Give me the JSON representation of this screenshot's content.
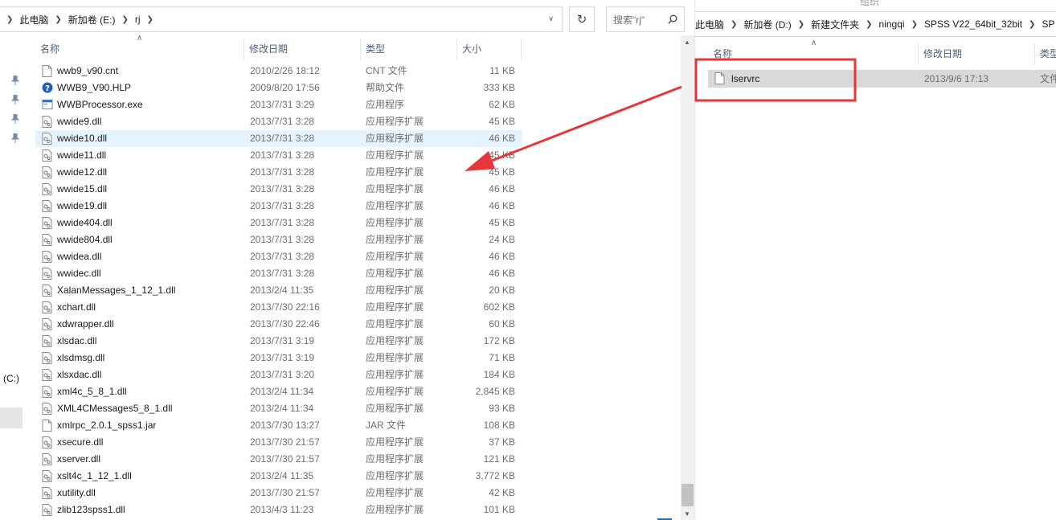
{
  "left_window": {
    "breadcrumb": [
      "此电脑",
      "新加卷 (E:)",
      "rj"
    ],
    "search_placeholder": "搜索\"rj\"",
    "columns": {
      "name": "名称",
      "date": "修改日期",
      "type": "类型",
      "size": "大小"
    },
    "nav": {
      "c_drive_label": "(C:)"
    },
    "files": [
      {
        "name": "wwb9_v90.cnt",
        "date": "2010/2/26 18:12",
        "type": "CNT 文件",
        "size": "11 KB",
        "icon": "file-icon"
      },
      {
        "name": "WWB9_V90.HLP",
        "date": "2009/8/20 17:56",
        "type": "帮助文件",
        "size": "333 KB",
        "icon": "help-file-icon"
      },
      {
        "name": "WWBProcessor.exe",
        "date": "2013/7/31 3:29",
        "type": "应用程序",
        "size": "62 KB",
        "icon": "exe-icon"
      },
      {
        "name": "wwide9.dll",
        "date": "2013/7/31 3:28",
        "type": "应用程序扩展",
        "size": "45 KB",
        "icon": "dll-icon"
      },
      {
        "name": "wwide10.dll",
        "date": "2013/7/31 3:28",
        "type": "应用程序扩展",
        "size": "46 KB",
        "icon": "dll-icon",
        "hover": true
      },
      {
        "name": "wwide11.dll",
        "date": "2013/7/31 3:28",
        "type": "应用程序扩展",
        "size": "45 KB",
        "icon": "dll-icon"
      },
      {
        "name": "wwide12.dll",
        "date": "2013/7/31 3:28",
        "type": "应用程序扩展",
        "size": "45 KB",
        "icon": "dll-icon"
      },
      {
        "name": "wwide15.dll",
        "date": "2013/7/31 3:28",
        "type": "应用程序扩展",
        "size": "46 KB",
        "icon": "dll-icon"
      },
      {
        "name": "wwide19.dll",
        "date": "2013/7/31 3:28",
        "type": "应用程序扩展",
        "size": "46 KB",
        "icon": "dll-icon"
      },
      {
        "name": "wwide404.dll",
        "date": "2013/7/31 3:28",
        "type": "应用程序扩展",
        "size": "45 KB",
        "icon": "dll-icon"
      },
      {
        "name": "wwide804.dll",
        "date": "2013/7/31 3:28",
        "type": "应用程序扩展",
        "size": "24 KB",
        "icon": "dll-icon"
      },
      {
        "name": "wwidea.dll",
        "date": "2013/7/31 3:28",
        "type": "应用程序扩展",
        "size": "46 KB",
        "icon": "dll-icon"
      },
      {
        "name": "wwidec.dll",
        "date": "2013/7/31 3:28",
        "type": "应用程序扩展",
        "size": "46 KB",
        "icon": "dll-icon"
      },
      {
        "name": "XalanMessages_1_12_1.dll",
        "date": "2013/2/4 11:35",
        "type": "应用程序扩展",
        "size": "20 KB",
        "icon": "dll-icon"
      },
      {
        "name": "xchart.dll",
        "date": "2013/7/30 22:16",
        "type": "应用程序扩展",
        "size": "602 KB",
        "icon": "dll-icon"
      },
      {
        "name": "xdwrapper.dll",
        "date": "2013/7/30 22:46",
        "type": "应用程序扩展",
        "size": "60 KB",
        "icon": "dll-icon"
      },
      {
        "name": "xlsdac.dll",
        "date": "2013/7/31 3:19",
        "type": "应用程序扩展",
        "size": "172 KB",
        "icon": "dll-icon"
      },
      {
        "name": "xlsdmsg.dll",
        "date": "2013/7/31 3:19",
        "type": "应用程序扩展",
        "size": "71 KB",
        "icon": "dll-icon"
      },
      {
        "name": "xlsxdac.dll",
        "date": "2013/7/31 3:20",
        "type": "应用程序扩展",
        "size": "184 KB",
        "icon": "dll-icon"
      },
      {
        "name": "xml4c_5_8_1.dll",
        "date": "2013/2/4 11:34",
        "type": "应用程序扩展",
        "size": "2,845 KB",
        "icon": "dll-icon"
      },
      {
        "name": "XML4CMessages5_8_1.dll",
        "date": "2013/2/4 11:34",
        "type": "应用程序扩展",
        "size": "93 KB",
        "icon": "dll-icon"
      },
      {
        "name": "xmlrpc_2.0.1_spss1.jar",
        "date": "2013/7/30 13:27",
        "type": "JAR 文件",
        "size": "108 KB",
        "icon": "file-icon"
      },
      {
        "name": "xsecure.dll",
        "date": "2013/7/30 21:57",
        "type": "应用程序扩展",
        "size": "37 KB",
        "icon": "dll-icon"
      },
      {
        "name": "xserver.dll",
        "date": "2013/7/30 21:57",
        "type": "应用程序扩展",
        "size": "121 KB",
        "icon": "dll-icon"
      },
      {
        "name": "xslt4c_1_12_1.dll",
        "date": "2013/2/4 11:35",
        "type": "应用程序扩展",
        "size": "3,772 KB",
        "icon": "dll-icon"
      },
      {
        "name": "xutility.dll",
        "date": "2013/7/30 21:57",
        "type": "应用程序扩展",
        "size": "42 KB",
        "icon": "dll-icon"
      },
      {
        "name": "zlib123spss1.dll",
        "date": "2013/4/3 11:23",
        "type": "应用程序扩展",
        "size": "101 KB",
        "icon": "dll-icon"
      }
    ]
  },
  "right_window": {
    "top_partial_text": "组织",
    "breadcrumb": [
      "此电脑",
      "新加卷 (D:)",
      "新建文件夹",
      "ningqi",
      "SPSS V22_64bit_32bit",
      "SP"
    ],
    "columns": {
      "name": "名称",
      "date": "修改日期",
      "type": "类型"
    },
    "files": [
      {
        "name": "lservrc",
        "date": "2013/9/6 17:13",
        "type": "文件",
        "selected": true,
        "icon": "file-icon"
      }
    ]
  },
  "annotation": {
    "color": "#e8353a"
  }
}
